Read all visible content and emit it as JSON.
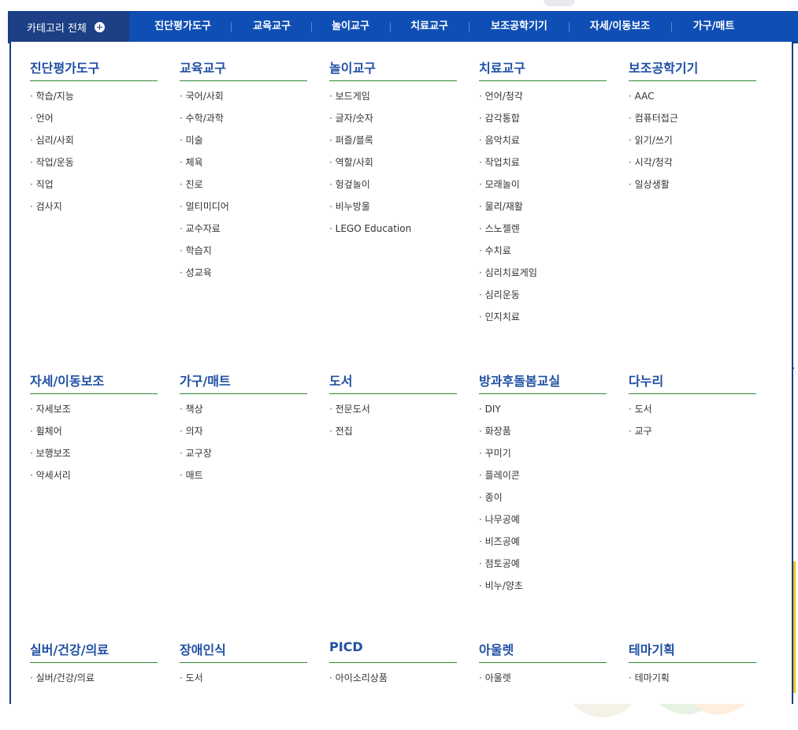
{
  "nav": {
    "all_label": "카테고리 전체",
    "items": [
      "진단평가도구",
      "교육교구",
      "놀이교구",
      "치료교구",
      "보조공학기기",
      "자세/이동보조",
      "가구/매트"
    ]
  },
  "categories": [
    {
      "title": "진단평가도구",
      "items": [
        "학습/지능",
        "언어",
        "심리/사회",
        "작업/운동",
        "직업",
        "검사지"
      ]
    },
    {
      "title": "교육교구",
      "items": [
        "국어/사회",
        "수학/과학",
        "미술",
        "체육",
        "진로",
        "멀티미디어",
        "교수자료",
        "학습지",
        "성교육"
      ]
    },
    {
      "title": "놀이교구",
      "items": [
        "보드게임",
        "글자/숫자",
        "퍼즐/블록",
        "역할/사회",
        "헝겊놀이",
        "비누방울",
        "LEGO Education"
      ]
    },
    {
      "title": "치료교구",
      "items": [
        "언어/청각",
        "감각통합",
        "음악치료",
        "작업치료",
        "모래놀이",
        "물리/재활",
        "스노젤렌",
        "수치료",
        "심리치료게임",
        "심리운동",
        "인지치료"
      ]
    },
    {
      "title": "보조공학기기",
      "items": [
        "AAC",
        "컴퓨터접근",
        "읽기/쓰기",
        "시각/청각",
        "일상생활"
      ]
    },
    {
      "title": "자세/이동보조",
      "items": [
        "자세보조",
        "휠체어",
        "보행보조",
        "악세서리"
      ]
    },
    {
      "title": "가구/매트",
      "items": [
        "책상",
        "의자",
        "교구장",
        "매트"
      ]
    },
    {
      "title": "도서",
      "items": [
        "전문도서",
        "전집"
      ]
    },
    {
      "title": "방과후돌봄교실",
      "items": [
        "DIY",
        "화장품",
        "꾸미기",
        "플레이콘",
        "종이",
        "나무공예",
        "비즈공예",
        "점토공예",
        "비누/양초"
      ]
    },
    {
      "title": "다누리",
      "items": [
        "도서",
        "교구"
      ]
    },
    {
      "title": "실버/건강/의료",
      "items": [
        "실버/건강/의료"
      ]
    },
    {
      "title": "장애인식",
      "items": [
        "도서"
      ]
    },
    {
      "title": "PICD",
      "items": [
        "아이소리상품"
      ]
    },
    {
      "title": "아울렛",
      "items": [
        "아울렛"
      ]
    },
    {
      "title": "테마기획",
      "items": [
        "테마기획"
      ]
    }
  ]
}
